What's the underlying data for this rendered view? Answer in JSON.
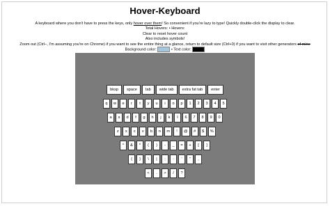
{
  "page": {
    "title": "Hover-Keyboard",
    "info_line_1_pre": "A keyboard where you don't have to press the keys, only ",
    "info_line_1_link": "hover over them",
    "info_line_1_post": "! So convenient if you're lazy to type! Quickly double-click the display to clear.",
    "info_line_2": "Total Hovers: • Hovers:",
    "info_line_3": "Clear to reset hover count",
    "info_line_4": "Also includes symbols!",
    "info_line_5_pre": "Zoom out (Ctrl−, I'm assuming you're on Chrome) if you want to see the entire thing at a glance, return to default size (Ctrl+0) if you want to visit other generators ",
    "info_line_5_strike": "of mine",
    "bg_color_label": "Background color:",
    "text_color_label": "• Text color:"
  },
  "colors": {
    "background_swatch": "#a7c7dc",
    "text_swatch": "#000000",
    "display_bg": "#7b7b7b"
  },
  "keyboard": {
    "rows": [
      [
        "bksp",
        "space",
        "tab",
        "wide tab",
        "extra fat tab",
        "enter"
      ],
      [
        "q",
        "w",
        "e",
        "r",
        "t",
        "y",
        "u",
        "i",
        "o",
        "p",
        "1",
        "2",
        "3",
        "4",
        "5"
      ],
      [
        "a",
        "s",
        "d",
        "f",
        "g",
        "h",
        "j",
        "k",
        "l",
        "6",
        "7",
        "8",
        "9",
        "0"
      ],
      [
        "z",
        "x",
        "c",
        "v",
        "b",
        "n",
        "m",
        "!",
        "@",
        "#",
        "$",
        "%"
      ],
      [
        "^",
        "&",
        "*",
        "(",
        ")",
        "-",
        "_",
        "=",
        "+",
        "[",
        "]"
      ],
      [
        "{",
        "}",
        "\\",
        "|",
        ";",
        ":",
        "'",
        "\"",
        ","
      ],
      [
        "<",
        ".",
        ">",
        "/",
        "?"
      ]
    ]
  }
}
